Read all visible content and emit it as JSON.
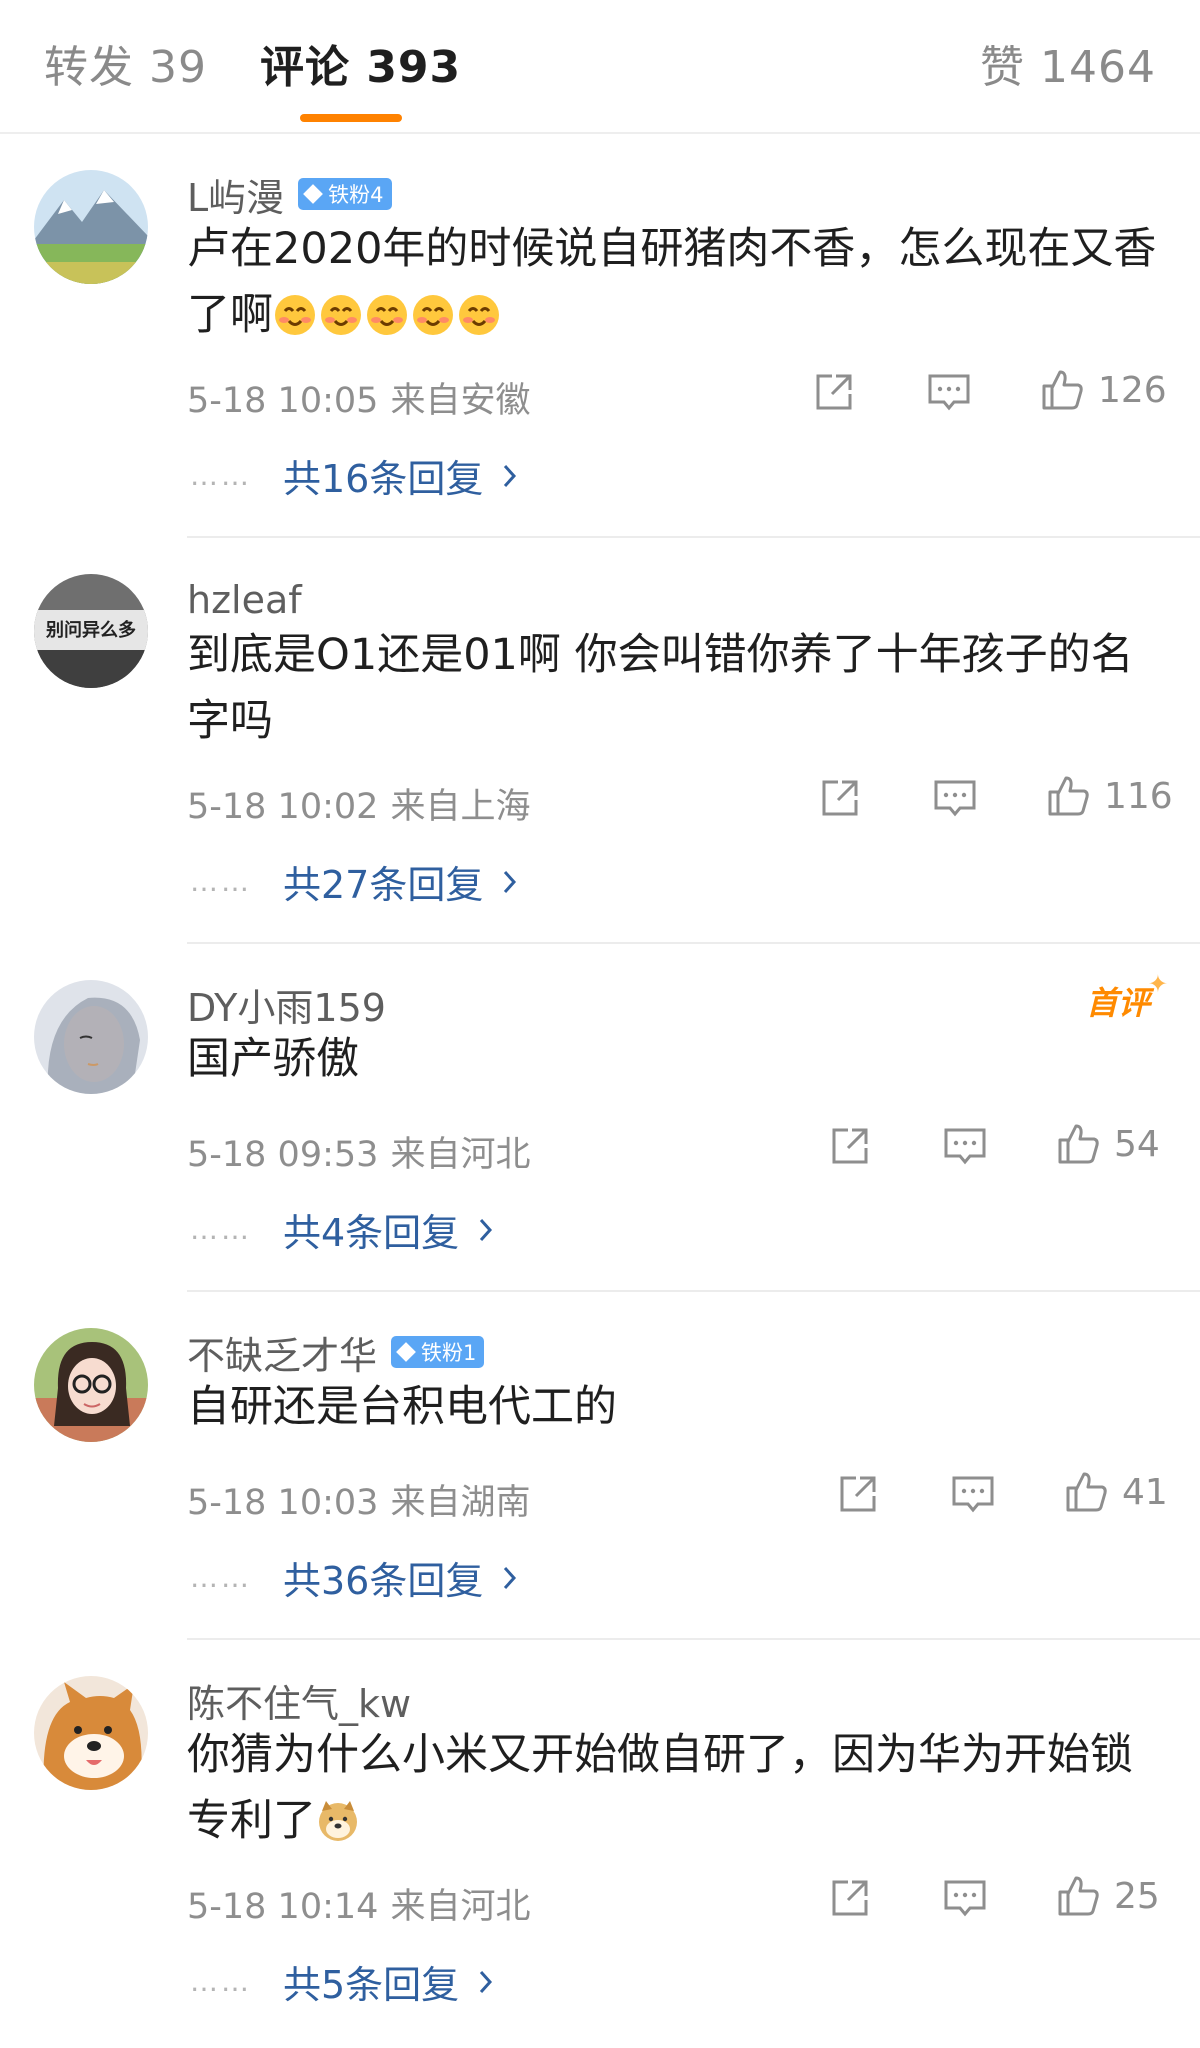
{
  "tabs": {
    "repost": "转发 39",
    "comments": "评论 393",
    "likes": "赞 1464"
  },
  "comments": [
    {
      "username": "L屿漫",
      "badge": "铁粉4",
      "text": "卢在2020年的时候说自研猪肉不香，怎么现在又香了啊",
      "emoji": "smiling-blush-emoji",
      "emoji_count": 5,
      "time": "5-18 10:05",
      "location": "来自安徽",
      "likes": "126",
      "replies": "共16条回复"
    },
    {
      "username": "hzleaf",
      "avatar_text": "别问异么多",
      "text": "到底是O1还是01啊 你会叫错你养了十年孩子的名字吗",
      "time": "5-18 10:02",
      "location": "来自上海",
      "likes": "116",
      "replies": "共27条回复"
    },
    {
      "username": "DY小雨159",
      "tag": "首评",
      "text": "国产骄傲",
      "time": "5-18 09:53",
      "location": "来自河北",
      "likes": "54",
      "replies": "共4条回复"
    },
    {
      "username": "不缺乏才华",
      "badge": "铁粉1",
      "text": "自研还是台积电代工的",
      "time": "5-18 10:03",
      "location": "来自湖南",
      "likes": "41",
      "replies": "共36条回复"
    },
    {
      "username": "陈不住气_kw",
      "text": "你猜为什么小米又开始做自研了，因为华为开始锁专利了",
      "emoji": "doge-emoji",
      "emoji_count": 1,
      "time": "5-18 10:14",
      "location": "来自河北",
      "likes": "25",
      "replies": "共5条回复"
    }
  ],
  "colors": {
    "accent": "#ff8200",
    "reply_link": "#2f5f9f",
    "badge": "#5aa6f5",
    "meta": "#8e8e8e"
  }
}
